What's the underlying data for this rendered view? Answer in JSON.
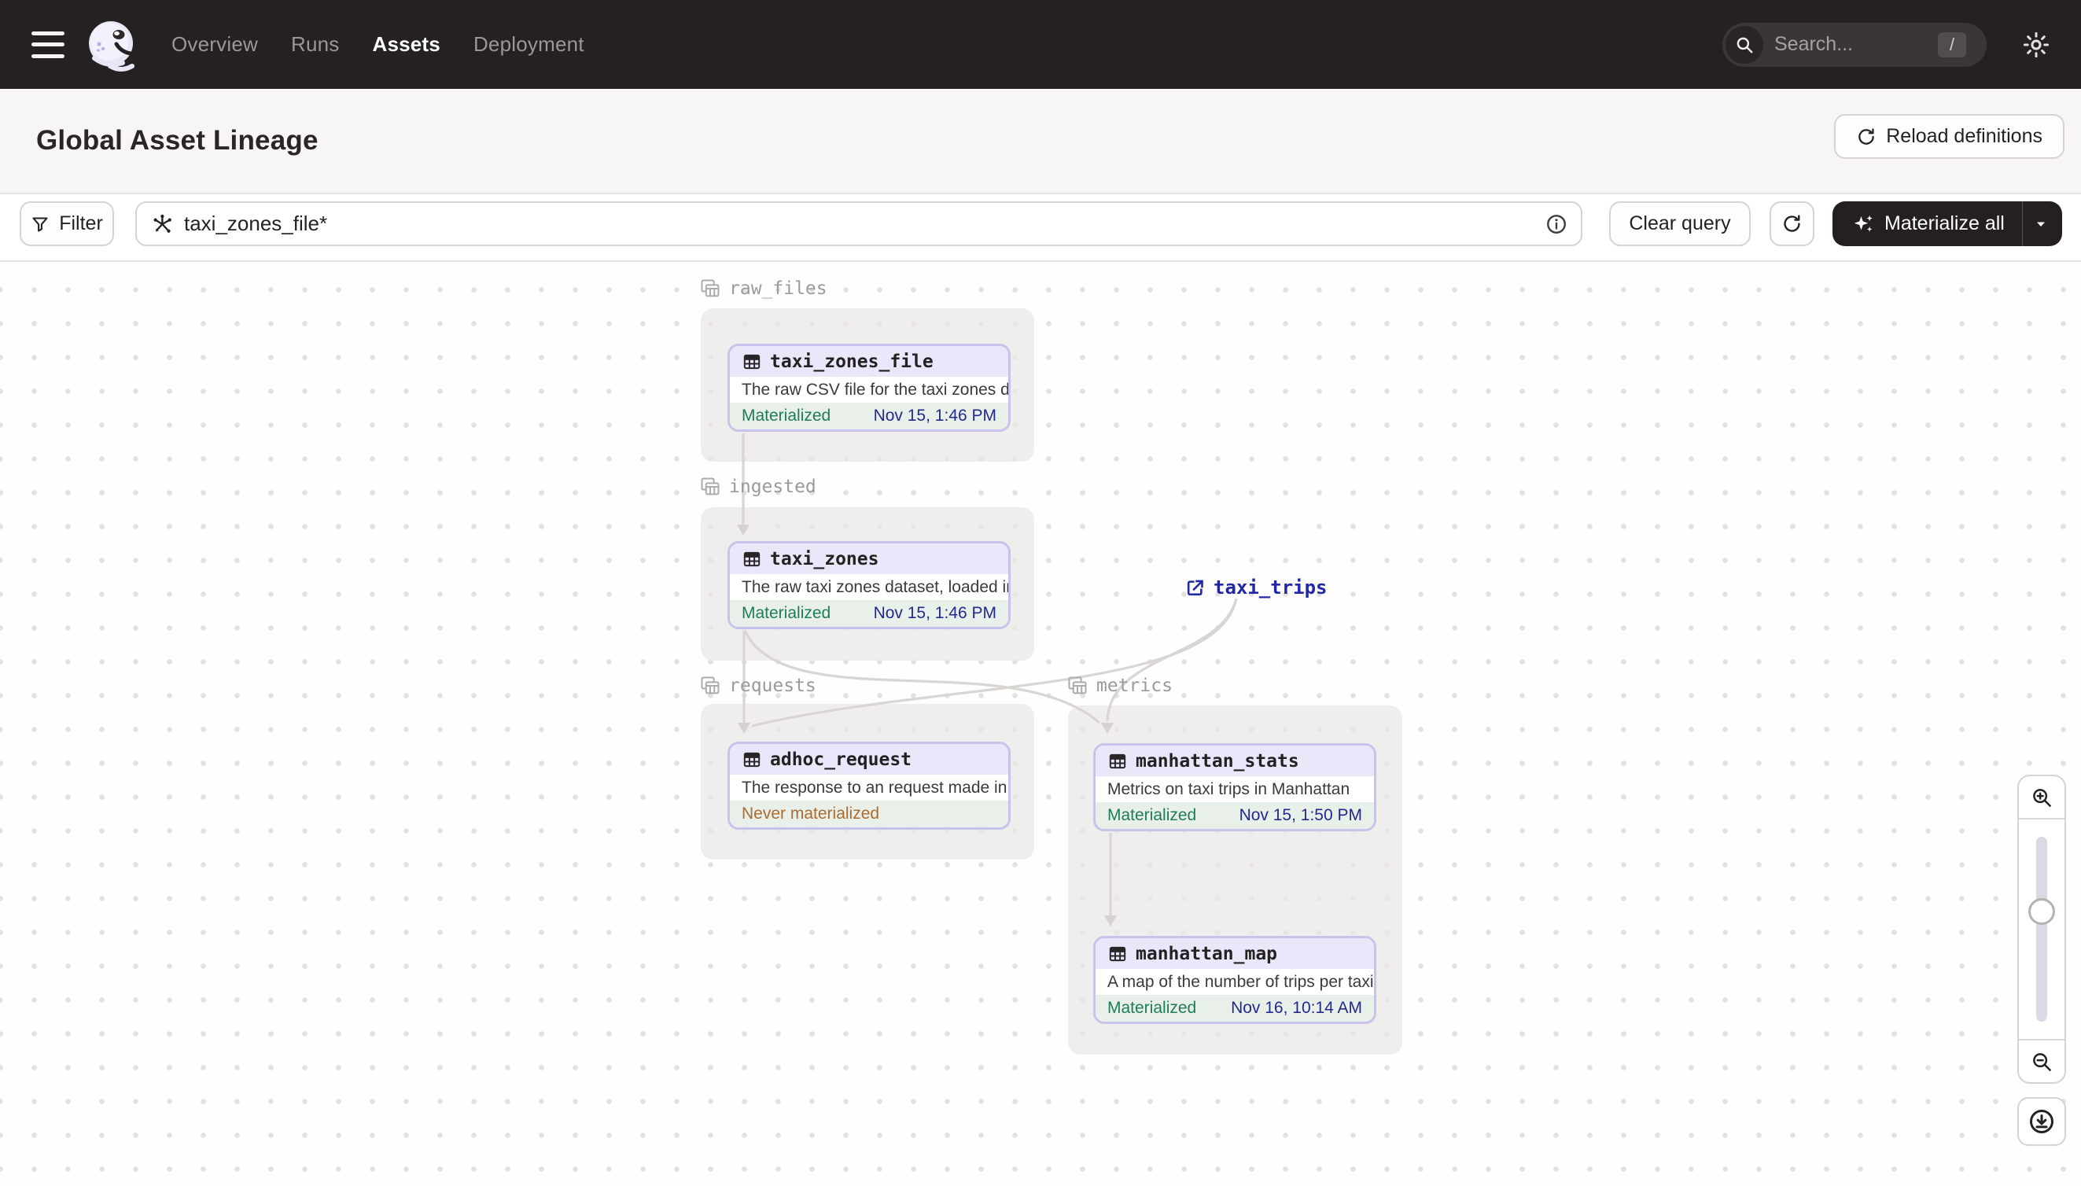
{
  "nav": {
    "items": [
      {
        "label": "Overview",
        "active": false
      },
      {
        "label": "Runs",
        "active": false
      },
      {
        "label": "Assets",
        "active": true
      },
      {
        "label": "Deployment",
        "active": false
      }
    ],
    "search_placeholder": "Search...",
    "search_shortcut": "/"
  },
  "header": {
    "title": "Global Asset Lineage",
    "reload_label": "Reload definitions"
  },
  "toolbar": {
    "filter_label": "Filter",
    "query_value": "taxi_zones_file*",
    "clear_label": "Clear query",
    "materialize_label": "Materialize all"
  },
  "graph": {
    "groups": [
      {
        "name": "raw_files"
      },
      {
        "name": "ingested"
      },
      {
        "name": "requests"
      },
      {
        "name": "metrics"
      }
    ],
    "nodes": [
      {
        "name": "taxi_zones_file",
        "description": "The raw CSV file for the taxi zones dat...",
        "status": "Materialized",
        "timestamp": "Nov 15, 1:46 PM",
        "group": "raw_files"
      },
      {
        "name": "taxi_zones",
        "description": "The raw taxi zones dataset, loaded int...",
        "status": "Materialized",
        "timestamp": "Nov 15, 1:46 PM",
        "group": "ingested"
      },
      {
        "name": "adhoc_request",
        "description": "The response to an request made in th...",
        "status": "Never materialized",
        "timestamp": "",
        "group": "requests"
      },
      {
        "name": "manhattan_stats",
        "description": "Metrics on taxi trips in Manhattan",
        "status": "Materialized",
        "timestamp": "Nov 15, 1:50 PM",
        "group": "metrics"
      },
      {
        "name": "manhattan_map",
        "description": "A map of the number of trips per taxi z...",
        "status": "Materialized",
        "timestamp": "Nov 16, 10:14 AM",
        "group": "metrics"
      }
    ],
    "external_asset": {
      "name": "taxi_trips"
    }
  },
  "colors": {
    "nav_background": "#252122",
    "node_border_lavender": "#c7c3ea",
    "node_header_lavender": "#e9e7f9",
    "materialized_green": "#1e7e54",
    "timestamp_navy": "#232a8e",
    "never_materialized_orange": "#ad6c2f",
    "external_link_navy": "#2227a5"
  }
}
